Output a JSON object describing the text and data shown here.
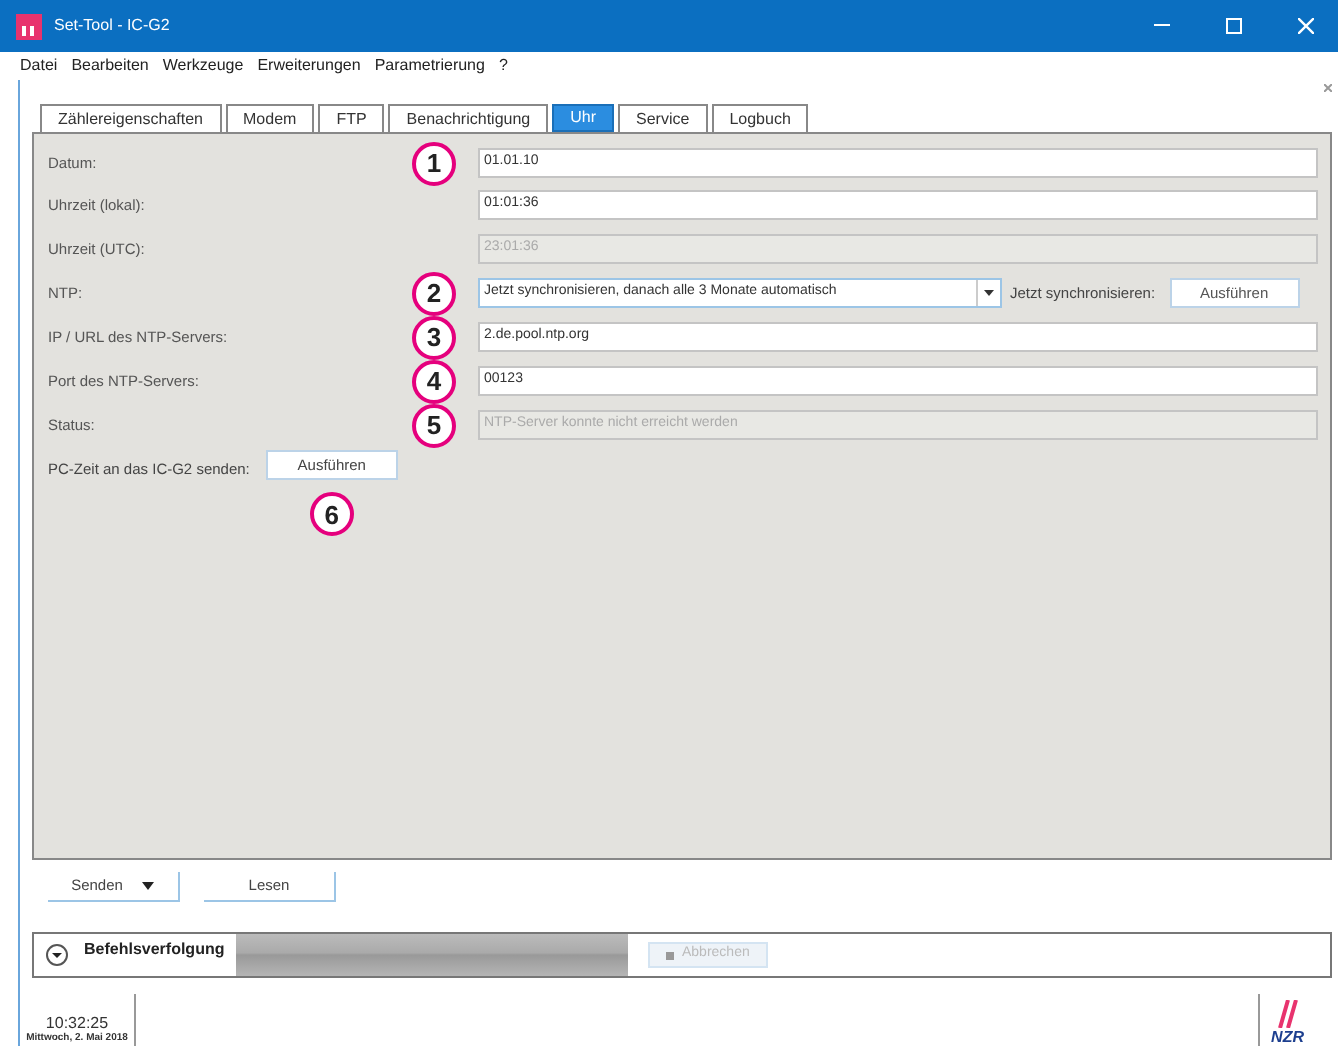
{
  "window": {
    "title": "Set-Tool - IC-G2"
  },
  "menu": [
    "Datei",
    "Bearbeiten",
    "Werkzeuge",
    "Erweiterungen",
    "Parametrierung",
    "?"
  ],
  "tabs": [
    {
      "label": "Zählereigenschaften",
      "selected": false
    },
    {
      "label": "Modem",
      "selected": false
    },
    {
      "label": "FTP",
      "selected": false
    },
    {
      "label": "Benachrichtigung",
      "selected": false
    },
    {
      "label": "Uhr",
      "selected": true
    },
    {
      "label": "Service",
      "selected": false
    },
    {
      "label": "Logbuch",
      "selected": false
    }
  ],
  "form": [
    {
      "kind": "input",
      "label": "Datum:",
      "value": "01.01.10",
      "disabled": false,
      "callout": "1"
    },
    {
      "kind": "input",
      "label": "Uhrzeit (lokal):",
      "value": "01:01:36",
      "disabled": false
    },
    {
      "kind": "input",
      "label": "Uhrzeit (UTC):",
      "value": "23:01:36",
      "disabled": true
    },
    {
      "kind": "select",
      "label": "NTP:",
      "value": "Jetzt synchronisieren, danach alle 3 Monate automatisch",
      "disabled": false,
      "callout": "2",
      "action_label": "Jetzt synchronisieren:",
      "action_button": "Ausführen"
    },
    {
      "kind": "input",
      "label": "IP / URL des NTP-Servers:",
      "value": "2.de.pool.ntp.org",
      "disabled": false,
      "callout": "3"
    },
    {
      "kind": "input",
      "label": "Port des NTP-Servers:",
      "value": "00123",
      "disabled": false,
      "callout": "4"
    },
    {
      "kind": "input",
      "label": "Status:",
      "value": "NTP-Server konnte nicht erreicht werden",
      "disabled": true,
      "callout": "5"
    },
    {
      "kind": "button",
      "label": "PC-Zeit an das IC-G2 senden:",
      "button": "Ausführen",
      "callout": "6"
    }
  ],
  "actions": [
    {
      "label": "Senden",
      "kind": "dropdown"
    },
    {
      "label": "Lesen",
      "kind": "plain"
    }
  ],
  "command_tracker": {
    "title": "Befehlsverfolgung",
    "level": 1,
    "cancel": "Abbrechen",
    "cancel_disabled": true
  },
  "footer": {
    "time": "10:32:25",
    "date": "Mittwoch, 2. Mai 2018",
    "logo": "NZR"
  }
}
